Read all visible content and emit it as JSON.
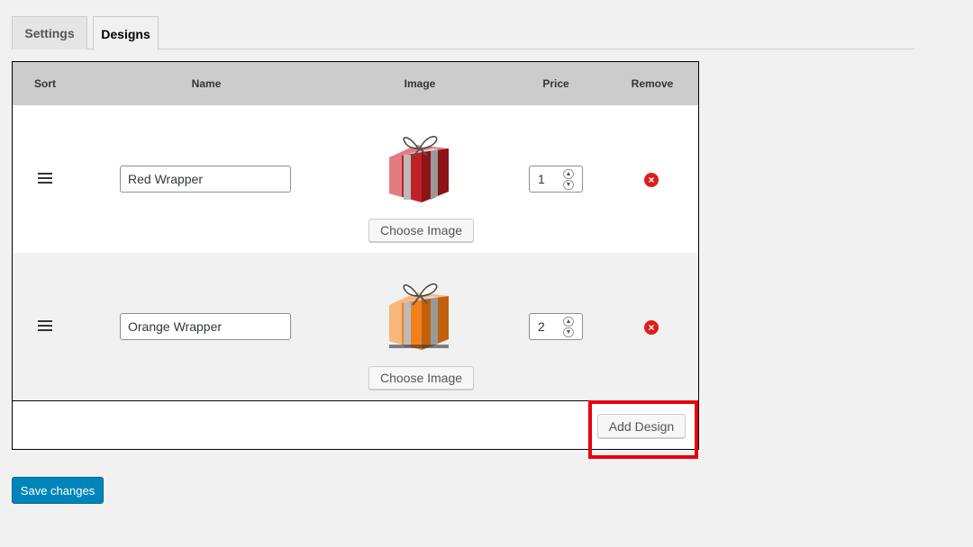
{
  "tabs": [
    {
      "label": "Settings",
      "active": false
    },
    {
      "label": "Designs",
      "active": true
    }
  ],
  "table": {
    "headers": {
      "sort": "Sort",
      "name": "Name",
      "image": "Image",
      "price": "Price",
      "remove": "Remove"
    },
    "rows": [
      {
        "name": "Red Wrapper",
        "image_icon": "red-gift-box-icon",
        "choose_image_label": "Choose Image",
        "price": "1",
        "box_color": "#c0202a",
        "box_light": "#e37b82"
      },
      {
        "name": "Orange Wrapper",
        "image_icon": "orange-gift-box-icon",
        "choose_image_label": "Choose Image",
        "price": "2",
        "box_color": "#f0821e",
        "box_light": "#f9b77a"
      }
    ],
    "add_design_label": "Add Design"
  },
  "save_label": "Save changes",
  "colors": {
    "accent": "#0085ba",
    "remove": "#dc1d1d",
    "highlight": "#e8000b"
  }
}
